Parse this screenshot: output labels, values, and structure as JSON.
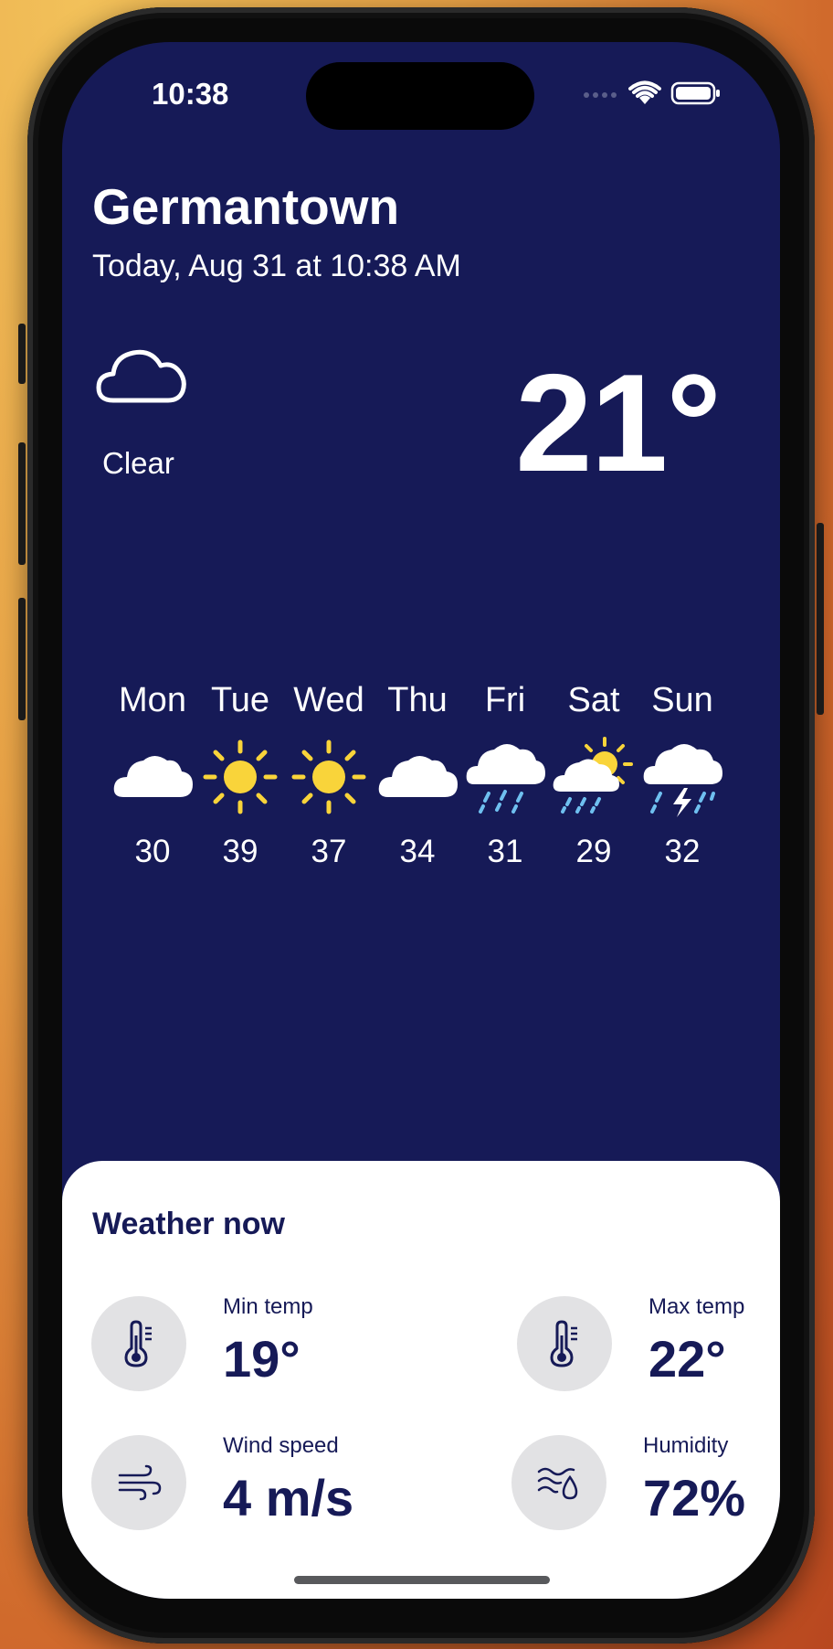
{
  "status_bar": {
    "time": "10:38"
  },
  "location": {
    "city": "Germantown",
    "date_text": "Today, Aug 31 at 10:38 AM"
  },
  "current": {
    "icon": "cloud-outline-icon",
    "condition": "Clear",
    "temperature": "21°"
  },
  "forecast": [
    {
      "day": "Mon",
      "icon": "cloud-icon",
      "value": "30"
    },
    {
      "day": "Tue",
      "icon": "sun-icon",
      "value": "39"
    },
    {
      "day": "Wed",
      "icon": "sun-icon",
      "value": "37"
    },
    {
      "day": "Thu",
      "icon": "cloud-icon",
      "value": "34"
    },
    {
      "day": "Fri",
      "icon": "rain-cloud-icon",
      "value": "31"
    },
    {
      "day": "Sat",
      "icon": "sun-cloud-rain-icon",
      "value": "29"
    },
    {
      "day": "Sun",
      "icon": "thunderstorm-icon",
      "value": "32"
    }
  ],
  "weather_now": {
    "title": "Weather now",
    "min_temp": {
      "label": "Min temp",
      "value": "19°",
      "icon": "thermometer-icon"
    },
    "max_temp": {
      "label": "Max temp",
      "value": "22°",
      "icon": "thermometer-icon"
    },
    "wind_speed": {
      "label": "Wind speed",
      "value": "4 m/s",
      "icon": "wind-icon"
    },
    "humidity": {
      "label": "Humidity",
      "value": "72%",
      "icon": "humidity-icon"
    }
  },
  "colors": {
    "background": "#161a57",
    "sun": "#f9d43a",
    "rain": "#6fc0f0",
    "card": "#ffffff",
    "circle": "#e2e2e4"
  }
}
